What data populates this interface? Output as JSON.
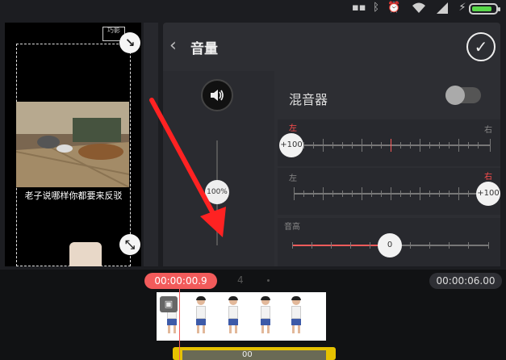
{
  "status_bar": {
    "icons": [
      "bluetooth-icon",
      "alarm-icon",
      "wifi-icon",
      "signal-icon",
      "charging-icon",
      "battery-icon"
    ],
    "battery_level": 0.85,
    "battery_color": "#59d84a"
  },
  "preview": {
    "watermark": "巧影",
    "subtitle": "老子说哪样你都要来反驳"
  },
  "volume_panel": {
    "title": "音量",
    "master_volume_label": "100%",
    "master_volume_level": 1.0
  },
  "mixer": {
    "label": "混音器",
    "enabled": false,
    "channel_1": {
      "left_label": "左",
      "right_label": "右",
      "value_label": "+100",
      "active_side": "left"
    },
    "channel_2": {
      "left_label": "左",
      "right_label": "右",
      "value_label": "+100",
      "active_side": "right"
    },
    "pitch": {
      "label": "音高",
      "value": "0"
    }
  },
  "timeline": {
    "current_time": "00:00:00.9",
    "total_time": "00:00:06.00",
    "ruler_mark": "4",
    "audio_clip_text": "00"
  },
  "colors": {
    "accent": "#f25b5b",
    "arrow": "#ff2222",
    "audio_clip": "#e6c200"
  }
}
